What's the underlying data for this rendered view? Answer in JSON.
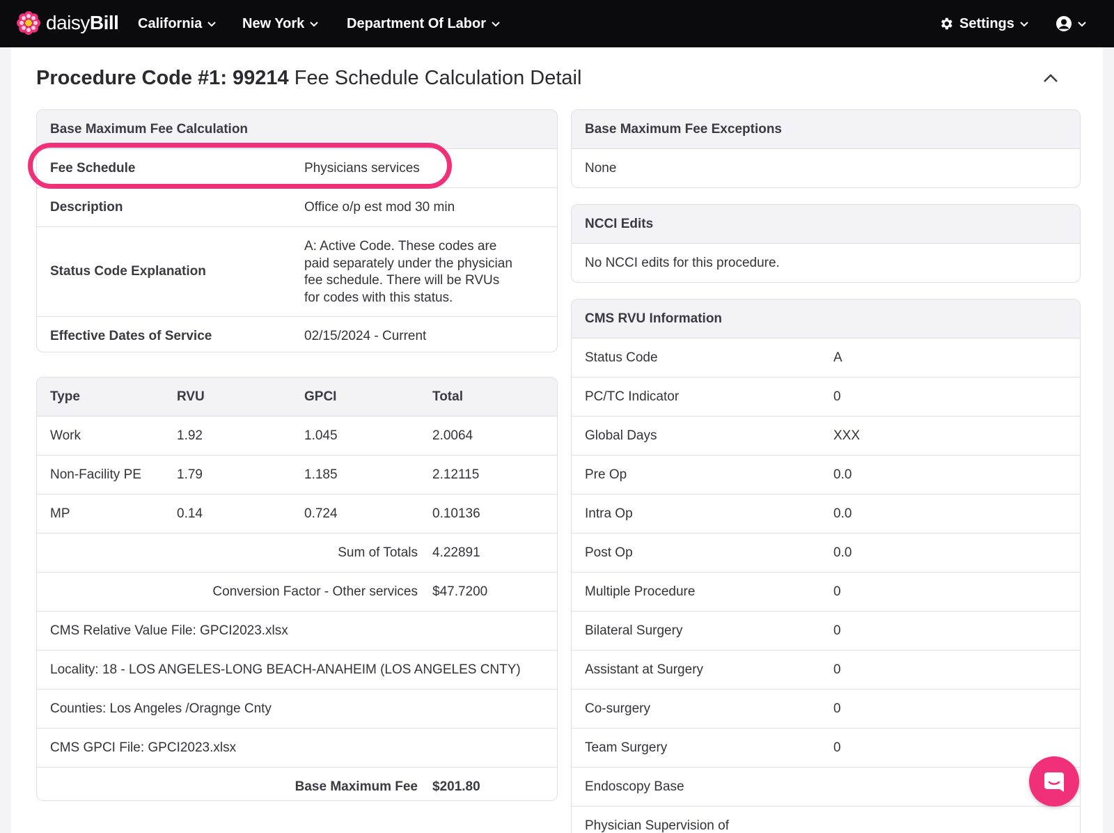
{
  "nav": {
    "logo_part1": "daisy",
    "logo_part2": "Bill",
    "items": [
      "California",
      "New York",
      "Department Of Labor"
    ],
    "settings_label": "Settings"
  },
  "page_title": {
    "bold": "Procedure Code #1: 99214",
    "rest": " Fee Schedule Calculation Detail"
  },
  "base_calc": {
    "header": "Base Maximum Fee Calculation",
    "rows": [
      {
        "label": "Fee Schedule",
        "value": "Physicians services"
      },
      {
        "label": "Description",
        "value": "Office o/p est mod 30 min"
      },
      {
        "label": "Status Code Explanation",
        "value_lines": [
          "A: Active Code. These codes are",
          "paid separately under the physician",
          "fee schedule. There will be RVUs",
          "for codes with this status."
        ]
      },
      {
        "label": "Effective Dates of Service",
        "value": "02/15/2024 - Current"
      }
    ]
  },
  "rvu_table": {
    "headers": [
      "Type",
      "RVU",
      "GPCI",
      "Total"
    ],
    "rows": [
      [
        "Work",
        "1.92",
        "1.045",
        "2.0064"
      ],
      [
        "Non-Facility PE",
        "1.79",
        "1.185",
        "2.12115"
      ],
      [
        "MP",
        "0.14",
        "0.724",
        "0.10136"
      ]
    ],
    "sum_label": "Sum of Totals",
    "sum_value": "4.22891",
    "cf_label": "Conversion Factor - Other services",
    "cf_value": "$47.7200",
    "info_rows": [
      "CMS Relative Value File: GPCI2023.xlsx",
      "Locality: 18 - LOS ANGELES-LONG BEACH-ANAHEIM (LOS ANGELES CNTY)",
      "Counties: Los Angeles /Oragnge Cnty",
      "CMS GPCI File: GPCI2023.xlsx"
    ],
    "base_fee_label": "Base Maximum Fee",
    "base_fee_value": "$201.80"
  },
  "exceptions": {
    "header": "Base Maximum Fee Exceptions",
    "value": "None"
  },
  "ncci": {
    "header": "NCCI Edits",
    "value": "No NCCI edits for this procedure."
  },
  "cms_rvu": {
    "header": "CMS RVU Information",
    "rows": [
      {
        "label": "Status Code",
        "value": "A"
      },
      {
        "label": "PC/TC Indicator",
        "value": "0"
      },
      {
        "label": "Global Days",
        "value": "XXX"
      },
      {
        "label": "Pre Op",
        "value": "0.0"
      },
      {
        "label": "Intra Op",
        "value": "0.0"
      },
      {
        "label": "Post Op",
        "value": "0.0"
      },
      {
        "label": "Multiple Procedure",
        "value": "0"
      },
      {
        "label": "Bilateral Surgery",
        "value": "0"
      },
      {
        "label": "Assistant at Surgery",
        "value": "0"
      },
      {
        "label": "Co-surgery",
        "value": "0"
      },
      {
        "label": "Team Surgery",
        "value": "0"
      },
      {
        "label": "Endoscopy Base",
        "value": ""
      },
      {
        "label": "Physician Supervision of",
        "value": ""
      }
    ]
  },
  "colors": {
    "accent": "#f0317a",
    "nav_bg": "#0b0b0d"
  }
}
